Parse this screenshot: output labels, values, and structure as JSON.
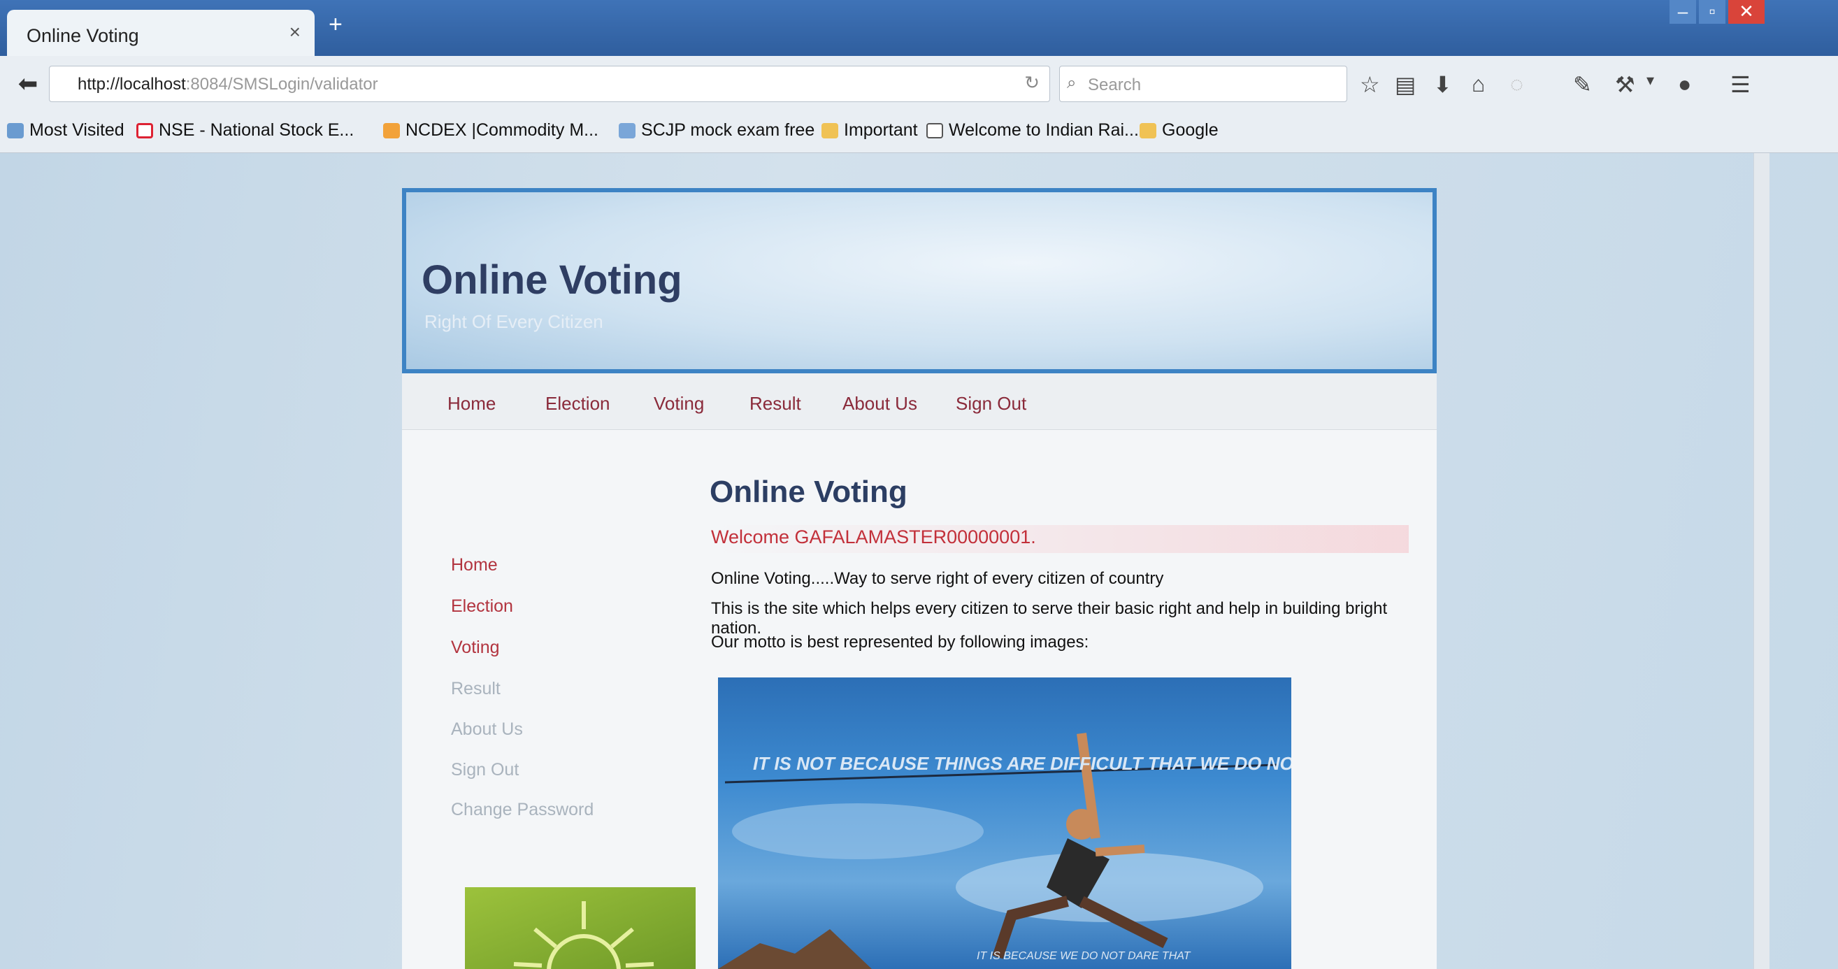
{
  "browser": {
    "tab_title": "Online Voting",
    "tab_close": "×",
    "new_tab": "+",
    "url_host": "http://localhost",
    "url_path": ":8084/SMSLogin/validator",
    "search_placeholder": "Search",
    "bookmarks": [
      {
        "label": "Most Visited"
      },
      {
        "label": "NSE - National Stock E..."
      },
      {
        "label": "NCDEX |Commodity M..."
      },
      {
        "label": "SCJP mock exam free"
      },
      {
        "label": "Important"
      },
      {
        "label": "Welcome to Indian Rai..."
      },
      {
        "label": "Google"
      }
    ]
  },
  "site": {
    "title": "Online Voting",
    "tagline": "Right Of Every Citizen",
    "menu": [
      "Home",
      "Election",
      "Voting",
      "Result",
      "About Us",
      "Sign Out"
    ],
    "sidebar": [
      "Home",
      "Election",
      "Voting",
      "Result",
      "About Us",
      "Sign Out",
      "Change Password"
    ],
    "content_title": "Online Voting",
    "welcome": "Welcome GAFALAMASTER00000001.",
    "para1": "Online Voting.....Way to serve right of every citizen of country",
    "para2": "This is the site which helps every citizen to serve their basic right and help in building bright nation.",
    "para3": "Our motto is best represented by following images:",
    "image_caption": "IT IS NOT BECAUSE THINGS ARE DIFFICULT THAT WE DO NOT DARE",
    "image_caption_bottom": "IT IS BECAUSE WE DO NOT DARE THAT"
  },
  "colors": {
    "accent": "#3d83c4",
    "menu_text": "#8a2a3a",
    "welcome": "#c2303a",
    "title": "#2f3e63"
  }
}
